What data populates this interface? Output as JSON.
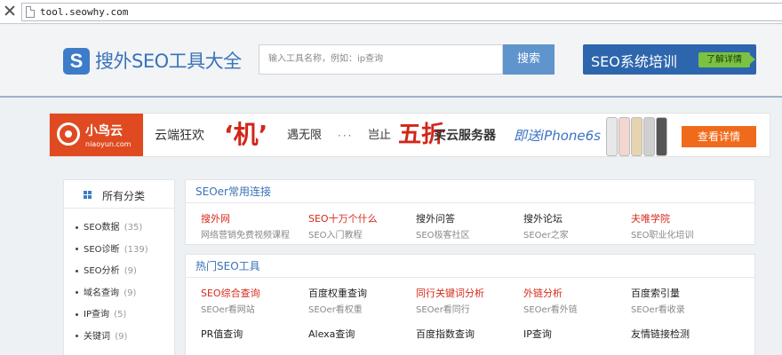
{
  "browser": {
    "url": "tool.seowhy.com"
  },
  "header": {
    "logo_letter": "S",
    "logo_text": "搜外SEO工具大全",
    "search_placeholder": "输入工具名称，例如：ip查询",
    "search_button": "搜索",
    "training_title": "SEO系统培训",
    "training_more": "了解详情"
  },
  "ad": {
    "brand_name": "小鸟云",
    "brand_domain": "niaoyun.com",
    "seg1": "云端狂欢",
    "seg2": "‘机’",
    "seg3": "遇无限",
    "seg4": "···",
    "seg5": "岂止",
    "seg6": "五折",
    "seg7": "买云服务器",
    "seg8": "即送iPhone6s",
    "cta": "查看详情"
  },
  "sidebar": {
    "title": "所有分类",
    "items": [
      {
        "label": "SEO数据",
        "count": "(35)"
      },
      {
        "label": "SEO诊断",
        "count": "(139)"
      },
      {
        "label": "SEO分析",
        "count": "(9)"
      },
      {
        "label": "域名查询",
        "count": "(9)"
      },
      {
        "label": "IP查询",
        "count": "(5)"
      },
      {
        "label": "关键词",
        "count": "(9)"
      }
    ]
  },
  "links_panel": {
    "title": "SEOer常用连接",
    "items": [
      {
        "name": "搜外网",
        "desc": "网络营销免费视频课程",
        "highlight": true
      },
      {
        "name": "SEO十万个什么",
        "desc": "SEO入门教程",
        "highlight": true
      },
      {
        "name": "搜外问答",
        "desc": "SEO极客社区",
        "highlight": false
      },
      {
        "name": "搜外论坛",
        "desc": "SEOer之家",
        "highlight": false
      },
      {
        "name": "夫唯学院",
        "desc": "SEO职业化培训",
        "highlight": true
      }
    ]
  },
  "tools_panel": {
    "title": "热门SEO工具",
    "row1": [
      {
        "name": "SEO综合查询",
        "desc": "SEOer看网站",
        "highlight": true
      },
      {
        "name": "百度权重查询",
        "desc": "SEOer看权重",
        "highlight": false
      },
      {
        "name": "同行关键词分析",
        "desc": "SEOer看同行",
        "highlight": true
      },
      {
        "name": "外链分析",
        "desc": "SEOer看外链",
        "highlight": true
      },
      {
        "name": "百度索引量",
        "desc": "SEOer看收录",
        "highlight": false
      }
    ],
    "row2": [
      {
        "name": "PR值查询"
      },
      {
        "name": "Alexa查询"
      },
      {
        "name": "百度指数查询"
      },
      {
        "name": "IP查询"
      },
      {
        "name": "友情链接检测"
      }
    ]
  },
  "colors": {
    "accent": "#3a72b8",
    "highlight": "#d52a1c",
    "ad_orange": "#f06a1c"
  }
}
